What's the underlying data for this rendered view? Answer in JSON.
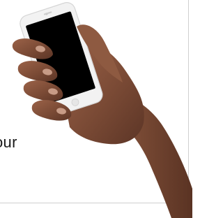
{
  "promo": {
    "text": "our"
  },
  "photo": {
    "subject_icon": "hand-holding-phone",
    "skin_color": "#7a4a35",
    "phone_body_color": "#f2f2f2",
    "phone_screen_color": "#000000"
  }
}
